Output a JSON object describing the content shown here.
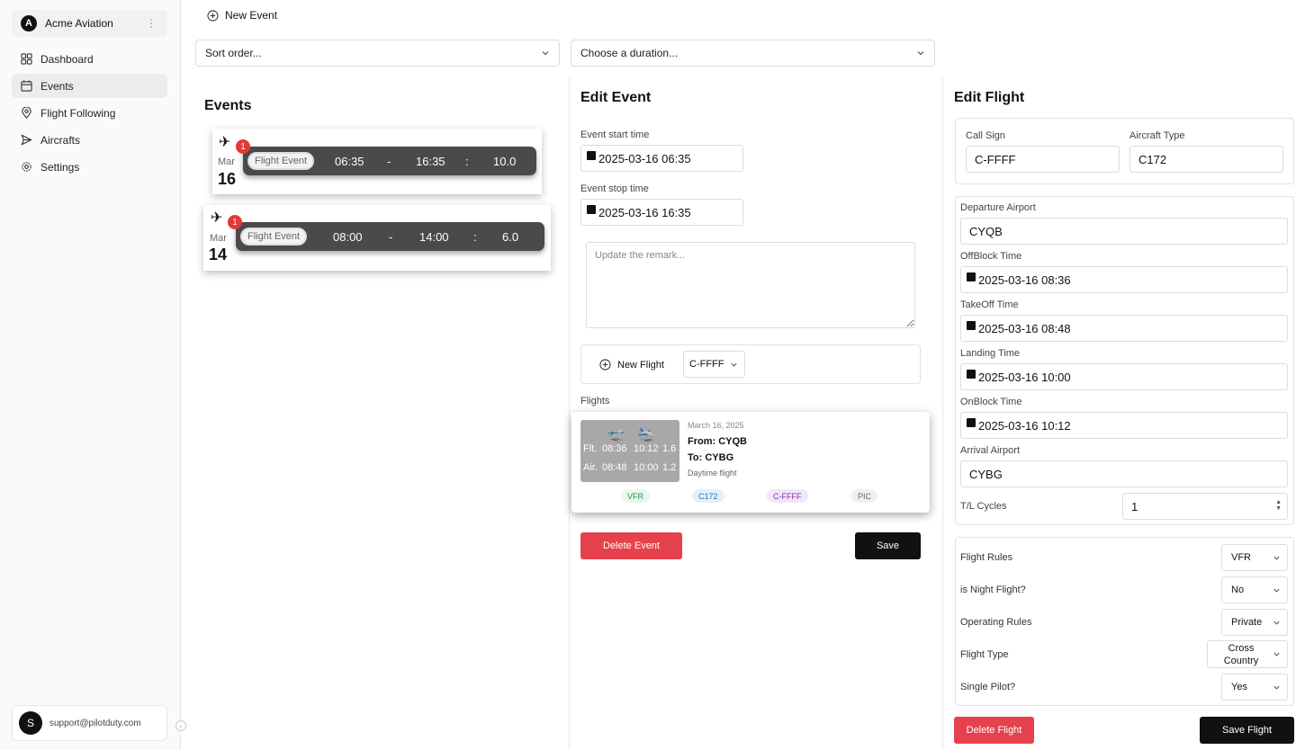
{
  "sidebar": {
    "org_initial": "A",
    "org_name": "Acme Aviation",
    "items": [
      {
        "label": "Dashboard",
        "icon": "dashboard-icon"
      },
      {
        "label": "Events",
        "icon": "calendar-icon",
        "active": true
      },
      {
        "label": "Flight Following",
        "icon": "location-pin-icon"
      },
      {
        "label": "Aircrafts",
        "icon": "send-icon"
      },
      {
        "label": "Settings",
        "icon": "gear-icon"
      }
    ],
    "user_initial": "S",
    "user_email": "support@pilotduty.com"
  },
  "toolbar": {
    "new_event_label": "New Event",
    "sort_placeholder": "Sort order...",
    "duration_placeholder": "Choose a duration..."
  },
  "events_panel": {
    "title": "Events",
    "events": [
      {
        "badge": "1",
        "month": "Mar",
        "day": "16",
        "tag": "Flight Event",
        "start": "06:35",
        "dash": "-",
        "end": "16:35",
        "colon": ":",
        "hours": "10.0"
      },
      {
        "badge": "1",
        "month": "Mar",
        "day": "14",
        "tag": "Flight Event",
        "start": "08:00",
        "dash": "-",
        "end": "14:00",
        "colon": ":",
        "hours": "6.0"
      }
    ]
  },
  "edit_event": {
    "title": "Edit Event",
    "start_label": "Event start time",
    "start_value": "2025-03-16 06:35",
    "stop_label": "Event stop time",
    "stop_value": "2025-03-16 16:35",
    "remark_placeholder": "Update the remark...",
    "new_flight_label": "New Flight",
    "aircraft_select": "C-FFFF",
    "flights_label": "Flights",
    "flight": {
      "flt_label": "Flt.",
      "flt_out": "08:36",
      "flt_in": "10:12",
      "flt_dur": "1.6",
      "air_label": "Air.",
      "air_out": "08:48",
      "air_in": "10:00",
      "air_dur": "1.2",
      "date": "March 16, 2025",
      "from": "From: CYQB",
      "to": "To: CYBG",
      "note": "Daytime flight",
      "chips": [
        "VFR",
        "C172",
        "C-FFFF",
        "PIC"
      ]
    },
    "delete_label": "Delete Event",
    "save_label": "Save"
  },
  "edit_flight": {
    "title": "Edit Flight",
    "call_sign_label": "Call Sign",
    "call_sign": "C-FFFF",
    "aircraft_type_label": "Aircraft Type",
    "aircraft_type": "C172",
    "departure_label": "Departure Airport",
    "departure": "CYQB",
    "offblock_label": "OffBlock Time",
    "offblock": "2025-03-16 08:36",
    "takeoff_label": "TakeOff Time",
    "takeoff": "2025-03-16 08:48",
    "landing_label": "Landing Time",
    "landing": "2025-03-16 10:00",
    "onblock_label": "OnBlock Time",
    "onblock": "2025-03-16 10:12",
    "arrival_label": "Arrival Airport",
    "arrival": "CYBG",
    "cycles_label": "T/L Cycles",
    "cycles": "1",
    "flight_rules_label": "Flight Rules",
    "flight_rules": "VFR",
    "night_label": "is Night Flight?",
    "night": "No",
    "operating_label": "Operating Rules",
    "operating": "Private",
    "type_label": "Flight Type",
    "type_line1": "Cross",
    "type_line2": "Country",
    "single_label": "Single Pilot?",
    "single": "Yes",
    "delete_label": "Delete Flight",
    "save_label": "Save Flight"
  }
}
